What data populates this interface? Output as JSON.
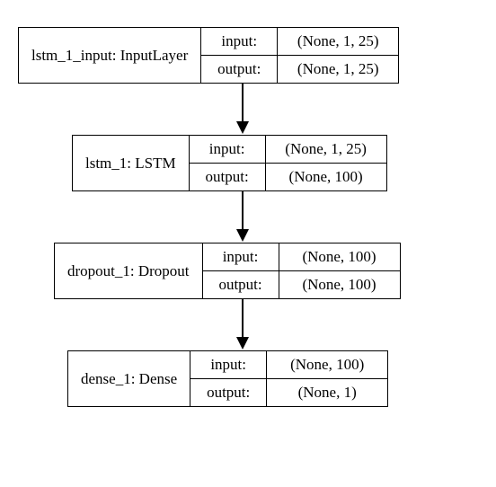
{
  "labels": {
    "input": "input:",
    "output": "output:"
  },
  "nodes": [
    {
      "name": "lstm_1_input: InputLayer",
      "input_shape": "(None, 1, 25)",
      "output_shape": "(None, 1, 25)"
    },
    {
      "name": "lstm_1: LSTM",
      "input_shape": "(None, 1, 25)",
      "output_shape": "(None, 100)"
    },
    {
      "name": "dropout_1: Dropout",
      "input_shape": "(None, 100)",
      "output_shape": "(None, 100)"
    },
    {
      "name": "dense_1: Dense",
      "input_shape": "(None, 100)",
      "output_shape": "(None, 1)"
    }
  ]
}
